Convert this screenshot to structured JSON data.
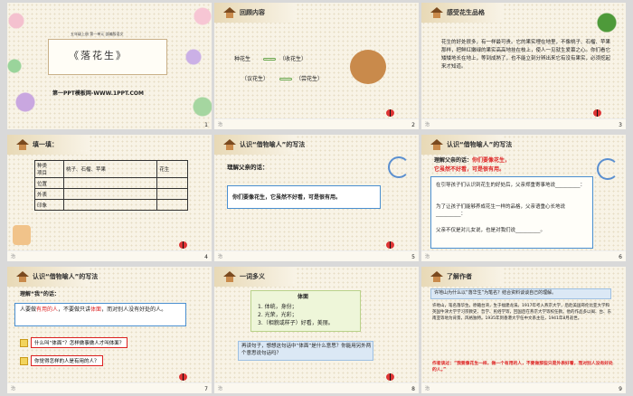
{
  "slides": [
    {
      "num": "1",
      "subtitle": "五年级上册 第一单元 部编版语文",
      "title": "《落花生》",
      "watermark": "第一PPT模板网-WWW.1PPT.COM"
    },
    {
      "num": "2",
      "header": "回顾内容",
      "items": [
        "种花生",
        "（收花生）",
        "（议花生）",
        "（尝花生）"
      ]
    },
    {
      "num": "3",
      "header": "感受花生品格",
      "body": "花生的好处很多，有一样最可贵。它的果实埋在地里，不像桃子、石榴、苹果那样，把鲜红嫩绿的果实高高地挂在枝上，使人一见就生爱慕之心。你们看它矮矮地长在地上，等到成熟了，也不能立刻分辨出来它有没有果实，必须挖起来才知道。"
    },
    {
      "num": "4",
      "header": "填一填：",
      "table_head": [
        "种类",
        "桃子、石榴、苹果",
        "花生"
      ],
      "table_row0_label": "项目",
      "rows": [
        "位置",
        "外表",
        "印象"
      ]
    },
    {
      "num": "5",
      "header": "认识“借物喻人”的写法",
      "lead": "理解父亲的话：",
      "quote": "你们要像花生，它虽然不好看，可是很有用。"
    },
    {
      "num": "6",
      "header": "认识“借物喻人”的写法",
      "lead": "理解父亲的话：",
      "quote_a": "你们要像花生，",
      "quote_b": "它虽然不好看，可是很有用。",
      "p1": "在引导孩子们认识到花生的好处后，父亲郑重寄事地说__________：",
      "p2": "为了让孩子们能够养成花生一样的品格，父亲语重心长地说__________：",
      "p3": "父亲不仅是对儿女说，也是对我们说__________。"
    },
    {
      "num": "7",
      "header": "认识“借物喻人”的写法",
      "lead": "理解“我”的话：",
      "body_a": "人要做",
      "em1": "有用的人",
      "body_b": "，不要做只讲",
      "em2": "体面",
      "body_c": "，而对别人没有好处的人。",
      "q1": "什么叫“体面”？怎样做事做人才叫体面？",
      "q2": "你觉得怎样的人是有用的人？"
    },
    {
      "num": "8",
      "header": "一词多义",
      "term": "体面",
      "senses": [
        "1. 体统，身份；",
        "2. 光荣，光彩；",
        "3.（相貌或样子）好看，美丽。"
      ],
      "question": "再读句子，想想这句话中“体面”是什么意思？你能用另外两个意思说句话吗？"
    },
    {
      "num": "9",
      "header": "了解作者",
      "prompt": "许地山为什么以“落华生”为笔名？结合资料谈谈自己的理解。",
      "bio": "许地山，笔名落华生。原籍台湾，生于福建龙溪。1917年考入燕京大学，后赴美国哥伦比亚大学和英国牛津大学学习宗教史、哲学、民俗学等，回国后在燕京大学等校任教。他的作品多以闽、台、东南亚等地为背景，风格独特。1935年到香港大学任中文系主任，1941年8月逝世。",
      "quote": "作者谈过：“我要像花生一样，做一个有用的人，不要做那些只是外表好看，而对别人没有好处的人。”"
    }
  ],
  "colors": {
    "accent_red": "#d22",
    "accent_blue": "#4a8fd0",
    "bg": "#f8f3e6"
  }
}
